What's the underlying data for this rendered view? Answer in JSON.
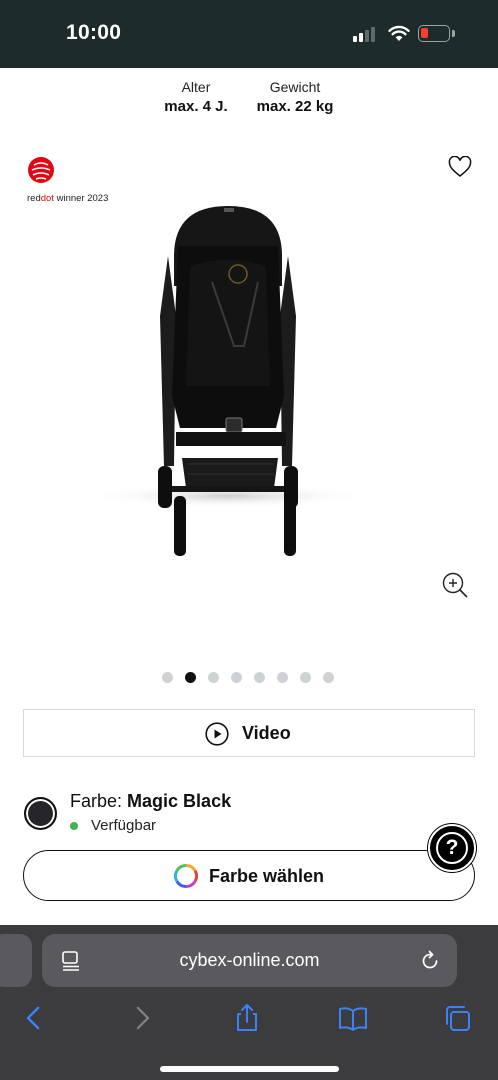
{
  "status_bar": {
    "time": "10:00",
    "battery_color": "#ff3b30"
  },
  "specs": [
    {
      "label": "Alter",
      "value": "max. 4 J."
    },
    {
      "label": "Gewicht",
      "value": "max. 22 kg"
    }
  ],
  "product": {
    "award_prefix": "red",
    "award_highlight": "dot",
    "award_suffix": " winner 2023",
    "image_count": 8,
    "active_image": 2
  },
  "video_button": {
    "label": "Video"
  },
  "color": {
    "label": "Farbe:",
    "value": "Magic Black",
    "availability": "Verfügbar",
    "swatch_color": "#26262a",
    "availability_color": "#3fb34f"
  },
  "help_button": {
    "label": "?"
  },
  "choose_color_button": {
    "label": "Farbe wählen"
  },
  "browser": {
    "url": "cybex-online.com",
    "accent": "#3b82f6"
  }
}
